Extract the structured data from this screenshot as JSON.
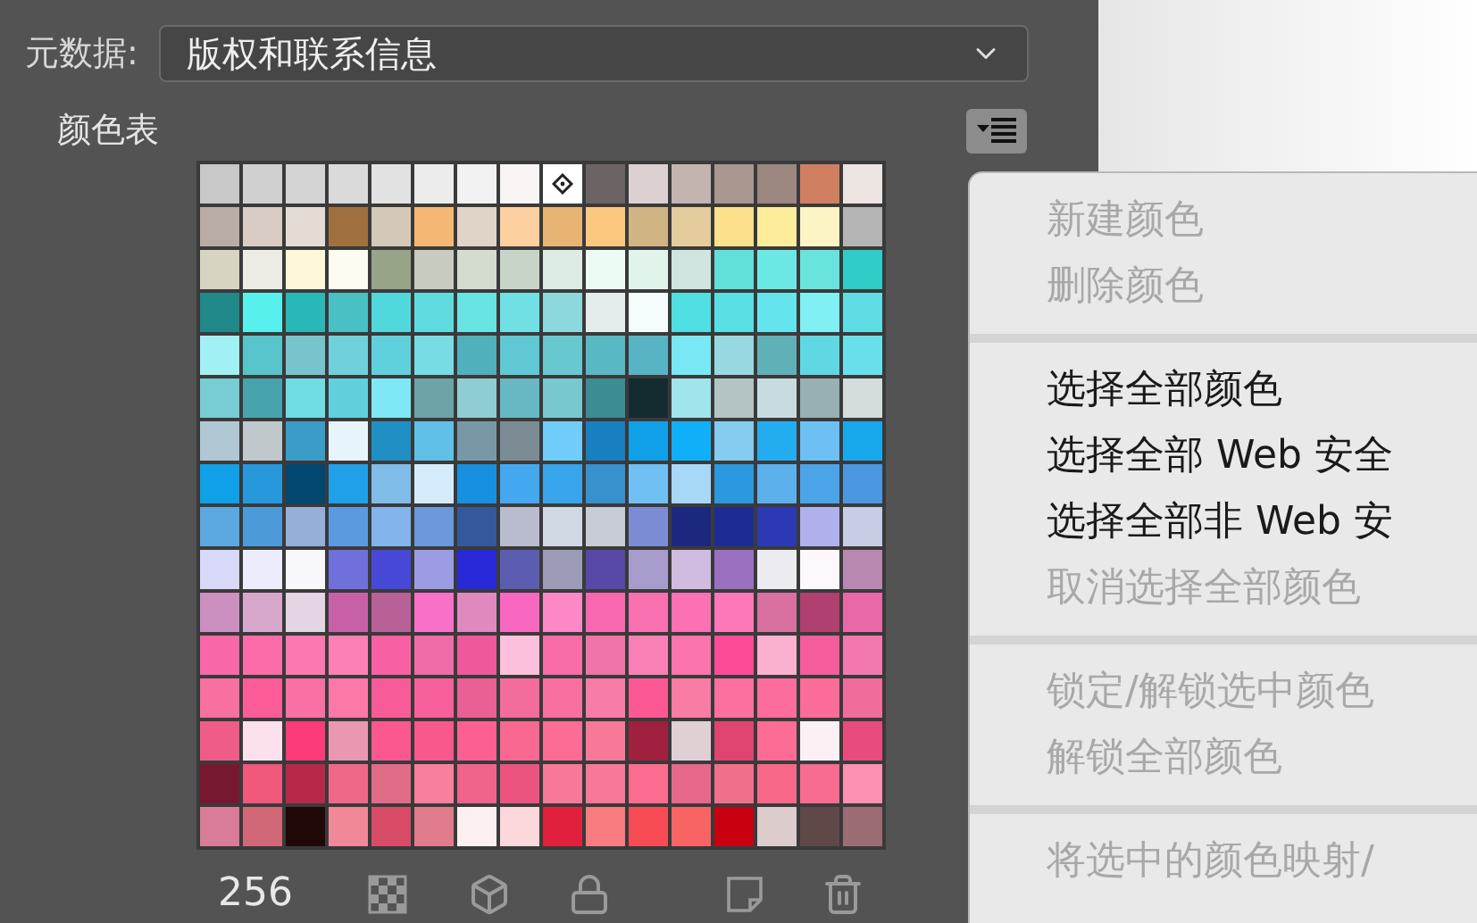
{
  "metadata": {
    "label": "元数据:",
    "value": "版权和联系信息"
  },
  "color_table": {
    "title": "颜色表",
    "count": "256",
    "rows": [
      [
        {
          "color": "#c8c8c8",
          "marked": false
        },
        {
          "color": "#d0d0d0",
          "marked": false
        },
        {
          "color": "#d4d4d4",
          "marked": false
        },
        {
          "color": "#dadada",
          "marked": false
        },
        {
          "color": "#e2e2e2",
          "marked": false
        },
        {
          "color": "#ececec",
          "marked": false
        },
        {
          "color": "#f2f2f2",
          "marked": false
        },
        {
          "color": "#f8f4f4",
          "marked": false
        },
        {
          "color": "#ffffff",
          "marked": true
        },
        {
          "color": "#6c6464",
          "marked": false
        },
        {
          "color": "#dcd0d0",
          "marked": false
        },
        {
          "color": "#c4b4b0",
          "marked": false
        },
        {
          "color": "#a89890",
          "marked": false
        },
        {
          "color": "#9c8880",
          "marked": false
        },
        {
          "color": "#d08060",
          "marked": false
        },
        {
          "color": "#ece4e0",
          "marked": false
        }
      ],
      [
        {
          "color": "#b8aca4",
          "marked": false
        },
        {
          "color": "#d8ccc4",
          "marked": false
        },
        {
          "color": "#e4dcd4",
          "marked": false
        },
        {
          "color": "#a07040",
          "marked": false
        },
        {
          "color": "#d4c8b8",
          "marked": false
        },
        {
          "color": "#f4b874",
          "marked": false
        },
        {
          "color": "#e0d4c8",
          "marked": false
        },
        {
          "color": "#fcd0a0",
          "marked": false
        },
        {
          "color": "#e8b474",
          "marked": false
        },
        {
          "color": "#fcc880",
          "marked": false
        },
        {
          "color": "#d0b484",
          "marked": false
        },
        {
          "color": "#e4cc9c",
          "marked": false
        },
        {
          "color": "#fce08c",
          "marked": false
        },
        {
          "color": "#fcec9c",
          "marked": false
        },
        {
          "color": "#fcf4c4",
          "marked": false
        },
        {
          "color": "#b4b4b4",
          "marked": false
        }
      ],
      [
        {
          "color": "#d8d4c4",
          "marked": false
        },
        {
          "color": "#ecece4",
          "marked": false
        },
        {
          "color": "#fcf8d8",
          "marked": false
        },
        {
          "color": "#fcfcf0",
          "marked": false
        },
        {
          "color": "#98a488",
          "marked": false
        },
        {
          "color": "#c8ccc0",
          "marked": false
        },
        {
          "color": "#d4dcd0",
          "marked": false
        },
        {
          "color": "#c8d4c8",
          "marked": false
        },
        {
          "color": "#dcece4",
          "marked": false
        },
        {
          "color": "#ecfcf4",
          "marked": false
        },
        {
          "color": "#e0f4ec",
          "marked": false
        },
        {
          "color": "#d0e4e0",
          "marked": false
        },
        {
          "color": "#60e0d8",
          "marked": false
        },
        {
          "color": "#6ce8e4",
          "marked": false
        },
        {
          "color": "#68e4dc",
          "marked": false
        },
        {
          "color": "#30ccc8",
          "marked": false
        }
      ],
      [
        {
          "color": "#208888",
          "marked": false
        },
        {
          "color": "#58f0ec",
          "marked": false
        },
        {
          "color": "#28b8b8",
          "marked": false
        },
        {
          "color": "#48c0c4",
          "marked": false
        },
        {
          "color": "#50d8dc",
          "marked": false
        },
        {
          "color": "#60dce0",
          "marked": false
        },
        {
          "color": "#68e4e4",
          "marked": false
        },
        {
          "color": "#70e0e4",
          "marked": false
        },
        {
          "color": "#8cd8dc",
          "marked": false
        },
        {
          "color": "#e4ecec",
          "marked": false
        },
        {
          "color": "#f4fcfc",
          "marked": false
        },
        {
          "color": "#50e0e4",
          "marked": false
        },
        {
          "color": "#58e0e4",
          "marked": false
        },
        {
          "color": "#64e4ec",
          "marked": false
        },
        {
          "color": "#80f0f4",
          "marked": false
        },
        {
          "color": "#60dce4",
          "marked": false
        }
      ],
      [
        {
          "color": "#a0f0f4",
          "marked": false
        },
        {
          "color": "#58c4cc",
          "marked": false
        },
        {
          "color": "#78c4cc",
          "marked": false
        },
        {
          "color": "#70d0dc",
          "marked": false
        },
        {
          "color": "#60d0dc",
          "marked": false
        },
        {
          "color": "#78dce4",
          "marked": false
        },
        {
          "color": "#50b0bc",
          "marked": false
        },
        {
          "color": "#60c8d4",
          "marked": false
        },
        {
          "color": "#68c8d0",
          "marked": false
        },
        {
          "color": "#58b8c4",
          "marked": false
        },
        {
          "color": "#58b4c4",
          "marked": false
        },
        {
          "color": "#78e8f4",
          "marked": false
        },
        {
          "color": "#98d8e0",
          "marked": false
        },
        {
          "color": "#60b0b8",
          "marked": false
        },
        {
          "color": "#60d8e4",
          "marked": false
        },
        {
          "color": "#68e0ec",
          "marked": false
        }
      ],
      [
        {
          "color": "#78ccd4",
          "marked": false
        },
        {
          "color": "#48a4ac",
          "marked": false
        },
        {
          "color": "#70dce4",
          "marked": false
        },
        {
          "color": "#60d0dc",
          "marked": false
        },
        {
          "color": "#80e8f4",
          "marked": false
        },
        {
          "color": "#6ca4a8",
          "marked": false
        },
        {
          "color": "#90ccd4",
          "marked": false
        },
        {
          "color": "#68b8c4",
          "marked": false
        },
        {
          "color": "#78c8d0",
          "marked": false
        },
        {
          "color": "#3c8c94",
          "marked": false
        },
        {
          "color": "#142c30",
          "marked": false
        },
        {
          "color": "#a0e4ec",
          "marked": false
        },
        {
          "color": "#b4c4c4",
          "marked": false
        },
        {
          "color": "#c8dce0",
          "marked": false
        },
        {
          "color": "#98b0b4",
          "marked": false
        },
        {
          "color": "#d4dcdc",
          "marked": false
        }
      ],
      [
        {
          "color": "#b0c8d4",
          "marked": false
        },
        {
          "color": "#c0c8cc",
          "marked": false
        },
        {
          "color": "#3c9cc8",
          "marked": false
        },
        {
          "color": "#e8f4fc",
          "marked": false
        },
        {
          "color": "#2090c4",
          "marked": false
        },
        {
          "color": "#60c0e8",
          "marked": false
        },
        {
          "color": "#7898a8",
          "marked": false
        },
        {
          "color": "#7c8c94",
          "marked": false
        },
        {
          "color": "#70ccf8",
          "marked": false
        },
        {
          "color": "#1880c0",
          "marked": false
        },
        {
          "color": "#10a0e8",
          "marked": false
        },
        {
          "color": "#10b0f8",
          "marked": false
        },
        {
          "color": "#84ccf0",
          "marked": false
        },
        {
          "color": "#24acf0",
          "marked": false
        },
        {
          "color": "#6cc0f4",
          "marked": false
        },
        {
          "color": "#18a8ec",
          "marked": false
        }
      ],
      [
        {
          "color": "#10a0e8",
          "marked": false
        },
        {
          "color": "#2898dc",
          "marked": false
        },
        {
          "color": "#004870",
          "marked": false
        },
        {
          "color": "#20a0e8",
          "marked": false
        },
        {
          "color": "#80bce8",
          "marked": false
        },
        {
          "color": "#d4ecfc",
          "marked": false
        },
        {
          "color": "#1890e0",
          "marked": false
        },
        {
          "color": "#44a8f0",
          "marked": false
        },
        {
          "color": "#38a4ec",
          "marked": false
        },
        {
          "color": "#3890cc",
          "marked": false
        },
        {
          "color": "#70c0f4",
          "marked": false
        },
        {
          "color": "#a8d8f8",
          "marked": false
        },
        {
          "color": "#2c98e0",
          "marked": false
        },
        {
          "color": "#5cb0ec",
          "marked": false
        },
        {
          "color": "#4ca4e8",
          "marked": false
        },
        {
          "color": "#4c98e0",
          "marked": false
        }
      ],
      [
        {
          "color": "#5ca8e0",
          "marked": false
        },
        {
          "color": "#4c9ad8",
          "marked": false
        },
        {
          "color": "#94b0d8",
          "marked": false
        },
        {
          "color": "#5c9ae0",
          "marked": false
        },
        {
          "color": "#84b4ec",
          "marked": false
        },
        {
          "color": "#6c98dc",
          "marked": false
        },
        {
          "color": "#34589c",
          "marked": false
        },
        {
          "color": "#b8bccc",
          "marked": false
        },
        {
          "color": "#d0d8e4",
          "marked": false
        },
        {
          "color": "#c8ccd4",
          "marked": false
        },
        {
          "color": "#7c8cd4",
          "marked": false
        },
        {
          "color": "#1c2880",
          "marked": false
        },
        {
          "color": "#1c2c94",
          "marked": false
        },
        {
          "color": "#2c38b4",
          "marked": false
        },
        {
          "color": "#b0b0ec",
          "marked": false
        },
        {
          "color": "#c8cce4",
          "marked": false
        }
      ],
      [
        {
          "color": "#d8d8f8",
          "marked": false
        },
        {
          "color": "#ececfc",
          "marked": false
        },
        {
          "color": "#f8f8fc",
          "marked": false
        },
        {
          "color": "#7070dc",
          "marked": false
        },
        {
          "color": "#4848d8",
          "marked": false
        },
        {
          "color": "#9c9ce4",
          "marked": false
        },
        {
          "color": "#2828d8",
          "marked": false
        },
        {
          "color": "#5c5cb0",
          "marked": false
        },
        {
          "color": "#9c9cb8",
          "marked": false
        },
        {
          "color": "#5848a8",
          "marked": false
        },
        {
          "color": "#a89ccc",
          "marked": false
        },
        {
          "color": "#d0bce0",
          "marked": false
        },
        {
          "color": "#9c70c0",
          "marked": false
        },
        {
          "color": "#ececf0",
          "marked": false
        },
        {
          "color": "#fcf8fc",
          "marked": false
        },
        {
          "color": "#b888b0",
          "marked": false
        }
      ],
      [
        {
          "color": "#cc90c0",
          "marked": false
        },
        {
          "color": "#d8a8cc",
          "marked": false
        },
        {
          "color": "#e4d4e4",
          "marked": false
        },
        {
          "color": "#c860a8",
          "marked": false
        },
        {
          "color": "#b86098",
          "marked": false
        },
        {
          "color": "#f870c8",
          "marked": false
        },
        {
          "color": "#e088c0",
          "marked": false
        },
        {
          "color": "#f868c0",
          "marked": false
        },
        {
          "color": "#fc88c8",
          "marked": false
        },
        {
          "color": "#f868b0",
          "marked": false
        },
        {
          "color": "#f870b0",
          "marked": false
        },
        {
          "color": "#fc70b4",
          "marked": false
        },
        {
          "color": "#fc78b8",
          "marked": false
        },
        {
          "color": "#d870a0",
          "marked": false
        },
        {
          "color": "#b04070",
          "marked": false
        },
        {
          "color": "#e868a8",
          "marked": false
        }
      ],
      [
        {
          "color": "#f868a8",
          "marked": false
        },
        {
          "color": "#fc6ca8",
          "marked": false
        },
        {
          "color": "#fc78b0",
          "marked": false
        },
        {
          "color": "#fc80b4",
          "marked": false
        },
        {
          "color": "#f860a4",
          "marked": false
        },
        {
          "color": "#f06ca8",
          "marked": false
        },
        {
          "color": "#f0589c",
          "marked": false
        },
        {
          "color": "#fcc0dc",
          "marked": false
        },
        {
          "color": "#f86ca8",
          "marked": false
        },
        {
          "color": "#f074a8",
          "marked": false
        },
        {
          "color": "#f880b4",
          "marked": false
        },
        {
          "color": "#fc74ac",
          "marked": false
        },
        {
          "color": "#fc4c98",
          "marked": false
        },
        {
          "color": "#fcb0d0",
          "marked": false
        },
        {
          "color": "#f45c9c",
          "marked": false
        },
        {
          "color": "#f478b0",
          "marked": false
        }
      ],
      [
        {
          "color": "#f870a0",
          "marked": false
        },
        {
          "color": "#fc5c98",
          "marked": false
        },
        {
          "color": "#f870a4",
          "marked": false
        },
        {
          "color": "#fc78a8",
          "marked": false
        },
        {
          "color": "#f85c98",
          "marked": false
        },
        {
          "color": "#f8609c",
          "marked": false
        },
        {
          "color": "#e86094",
          "marked": false
        },
        {
          "color": "#f46c9c",
          "marked": false
        },
        {
          "color": "#f870a0",
          "marked": false
        },
        {
          "color": "#f87ca8",
          "marked": false
        },
        {
          "color": "#fc5894",
          "marked": false
        },
        {
          "color": "#f87ca4",
          "marked": false
        },
        {
          "color": "#fc70a0",
          "marked": false
        },
        {
          "color": "#fc6c9c",
          "marked": false
        },
        {
          "color": "#fc6c98",
          "marked": false
        },
        {
          "color": "#f06c9c",
          "marked": false
        }
      ],
      [
        {
          "color": "#f05c88",
          "marked": false
        },
        {
          "color": "#fce0ec",
          "marked": false
        },
        {
          "color": "#fc3c78",
          "marked": false
        },
        {
          "color": "#e898b0",
          "marked": false
        },
        {
          "color": "#fc5890",
          "marked": false
        },
        {
          "color": "#f8588c",
          "marked": false
        },
        {
          "color": "#fc6090",
          "marked": false
        },
        {
          "color": "#f86890",
          "marked": false
        },
        {
          "color": "#fc6c94",
          "marked": false
        },
        {
          "color": "#f87898",
          "marked": false
        },
        {
          "color": "#a02040",
          "marked": false
        },
        {
          "color": "#e0d0d4",
          "marked": false
        },
        {
          "color": "#e04470",
          "marked": false
        },
        {
          "color": "#fc6c94",
          "marked": false
        },
        {
          "color": "#fcf0f4",
          "marked": false
        },
        {
          "color": "#e84c7c",
          "marked": false
        }
      ],
      [
        {
          "color": "#781830",
          "marked": false
        },
        {
          "color": "#f0587c",
          "marked": false
        },
        {
          "color": "#b82848",
          "marked": false
        },
        {
          "color": "#f06888",
          "marked": false
        },
        {
          "color": "#e06c88",
          "marked": false
        },
        {
          "color": "#f8809c",
          "marked": false
        },
        {
          "color": "#f0648c",
          "marked": false
        },
        {
          "color": "#ec5480",
          "marked": false
        },
        {
          "color": "#f87898",
          "marked": false
        },
        {
          "color": "#f87899",
          "marked": false
        },
        {
          "color": "#fc6c90",
          "marked": false
        },
        {
          "color": "#e8688c",
          "marked": false
        },
        {
          "color": "#f0708c",
          "marked": false
        },
        {
          "color": "#f86888",
          "marked": false
        },
        {
          "color": "#f86c90",
          "marked": false
        },
        {
          "color": "#fc90b0",
          "marked": false
        }
      ],
      [
        {
          "color": "#d87c98",
          "marked": false
        },
        {
          "color": "#d06878",
          "marked": false
        },
        {
          "color": "#200808",
          "marked": false
        },
        {
          "color": "#f08898",
          "marked": false
        },
        {
          "color": "#d84c68",
          "marked": false
        },
        {
          "color": "#e07c8c",
          "marked": false
        },
        {
          "color": "#fcf0f0",
          "marked": false
        },
        {
          "color": "#fcd8dc",
          "marked": false
        },
        {
          "color": "#e0203c",
          "marked": false
        },
        {
          "color": "#f87c80",
          "marked": false
        },
        {
          "color": "#f84c54",
          "marked": false
        },
        {
          "color": "#f86464",
          "marked": false
        },
        {
          "color": "#c80010",
          "marked": false
        },
        {
          "color": "#dccccc",
          "marked": false
        },
        {
          "color": "#604848",
          "marked": false
        },
        {
          "color": "#9c6c74",
          "marked": false
        }
      ]
    ]
  },
  "menu": {
    "items": [
      {
        "kind": "item",
        "label": "新建颜色",
        "disabled": true
      },
      {
        "kind": "item",
        "label": "删除颜色",
        "disabled": true
      },
      {
        "kind": "separator"
      },
      {
        "kind": "item",
        "label": "选择全部颜色",
        "disabled": false
      },
      {
        "kind": "item",
        "label": "选择全部 Web 安全",
        "disabled": false
      },
      {
        "kind": "item",
        "label": "选择全部非 Web 安",
        "disabled": false
      },
      {
        "kind": "item",
        "label": "取消选择全部颜色",
        "disabled": true
      },
      {
        "kind": "separator"
      },
      {
        "kind": "item",
        "label": "锁定/解锁选中颜色",
        "disabled": true
      },
      {
        "kind": "item",
        "label": "解锁全部颜色",
        "disabled": true
      },
      {
        "kind": "separator"
      },
      {
        "kind": "item",
        "label": "将选中的颜色映射/",
        "disabled": true
      }
    ]
  }
}
